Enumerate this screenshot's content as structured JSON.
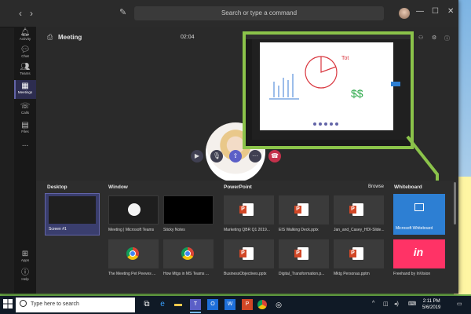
{
  "titlebar": {
    "search_placeholder": "Search or type a command",
    "icons": [
      "back-arrow-icon",
      "forward-arrow-icon",
      "compose-icon",
      "avatar",
      "minimize-icon",
      "maximize-icon",
      "close-icon"
    ]
  },
  "rail": {
    "items": [
      {
        "label": "Activity",
        "icon": "bell-icon"
      },
      {
        "label": "Chat",
        "icon": "chat-icon"
      },
      {
        "label": "Teams",
        "icon": "teams-icon"
      },
      {
        "label": "Meetings",
        "icon": "calendar-icon",
        "active": true
      },
      {
        "label": "Calls",
        "icon": "phone-icon"
      },
      {
        "label": "Files",
        "icon": "file-icon"
      },
      {
        "label": "...",
        "icon": "more-icon"
      }
    ],
    "bottom": [
      {
        "label": "Apps",
        "icon": "apps-icon"
      },
      {
        "label": "Help",
        "icon": "help-icon"
      }
    ]
  },
  "meeting": {
    "title": "Meeting",
    "time": "02:04"
  },
  "share": {
    "sections": {
      "desktop": "Desktop",
      "window": "Window",
      "powerpoint": "PowerPoint",
      "browse": "Browse",
      "whiteboard": "Whiteboard"
    },
    "desktop_tiles": [
      "Screen #1"
    ],
    "window_tiles": [
      "Meeting | Microsoft Teams",
      "Sticky Notes",
      "The Meeting Pet Peeves ...",
      "How Mtgs in MS Teams ..."
    ],
    "ppt_tiles": [
      "Marketing QBR Q1 2019...",
      "EIS Walking Deck.pptx",
      "Jan_and_Casey_HDI-Slide...",
      "BusinessObjectives.pptx",
      "Digital_Transformation.p...",
      "Mktg Personas.pptm"
    ],
    "whiteboard_tiles": [
      "Microsoft Whiteboard",
      "Freehand by InVision"
    ],
    "invision_logo": "in"
  },
  "preview": {
    "handwriting": "Tot",
    "dollars": "$$"
  },
  "taskbar": {
    "search_placeholder": "Type here to search",
    "time": "2:11 PM",
    "date": "5/6/2019"
  },
  "colors": {
    "accent": "#6264a7",
    "highlight": "#8bc34a",
    "hangup": "#c4314b"
  }
}
